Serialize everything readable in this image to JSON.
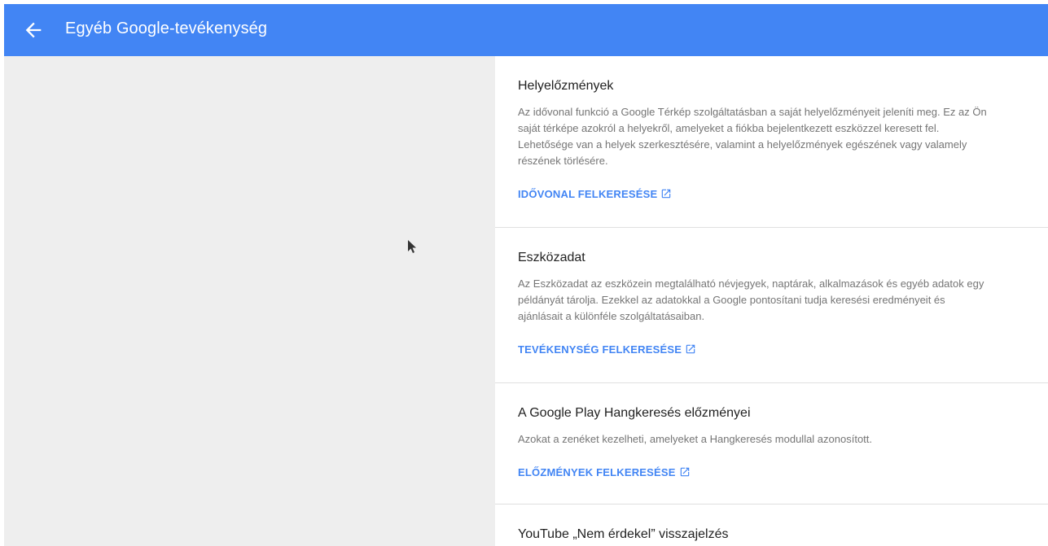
{
  "header": {
    "title": "Egyéb Google-tevékenység",
    "back_icon": "arrow-back-icon",
    "color": "#4285f4"
  },
  "sections": [
    {
      "title": "Helyelőzmények",
      "description": "Az idővonal funkció a Google Térkép szolgáltatásban a saját helyelőzményeit jeleníti meg. Ez az Ön\nsaját térképe azokról a helyekről, amelyeket a fiókba bejelentkezett eszközzel keresett fel.\nLehetősége van a helyek szerkesztésére, valamint a helyelőzmények egészének vagy valamely\nrészének törlésére.",
      "link": "IDŐVONAL FELKERESÉSE"
    },
    {
      "title": "Eszközadat",
      "description": "Az Eszközadat az eszközein megtalálható névjegyek, naptárak, alkalmazások és egyéb adatok egy\npéldányát tárolja. Ezekkel az adatokkal a Google pontosítani tudja keresési eredményeit és\najánlásait a különféle szolgáltatásaiban.",
      "link": "TEVÉKENYSÉG FELKERESÉSE"
    },
    {
      "title": "A Google Play Hangkeresés előzményei",
      "description": "Azokat a zenéket kezelheti, amelyeket a Hangkeresés modullal azonosított.",
      "link": "ELŐZMÉNYEK FELKERESÉSE"
    },
    {
      "title": "YouTube „Nem érdekel” visszajelzés"
    }
  ],
  "icons": {
    "external_link": "open-in-new-icon",
    "pointer": "mouse-cursor-icon"
  },
  "colors": {
    "link": "#4285f4",
    "left_pane": "#eeeeee"
  }
}
